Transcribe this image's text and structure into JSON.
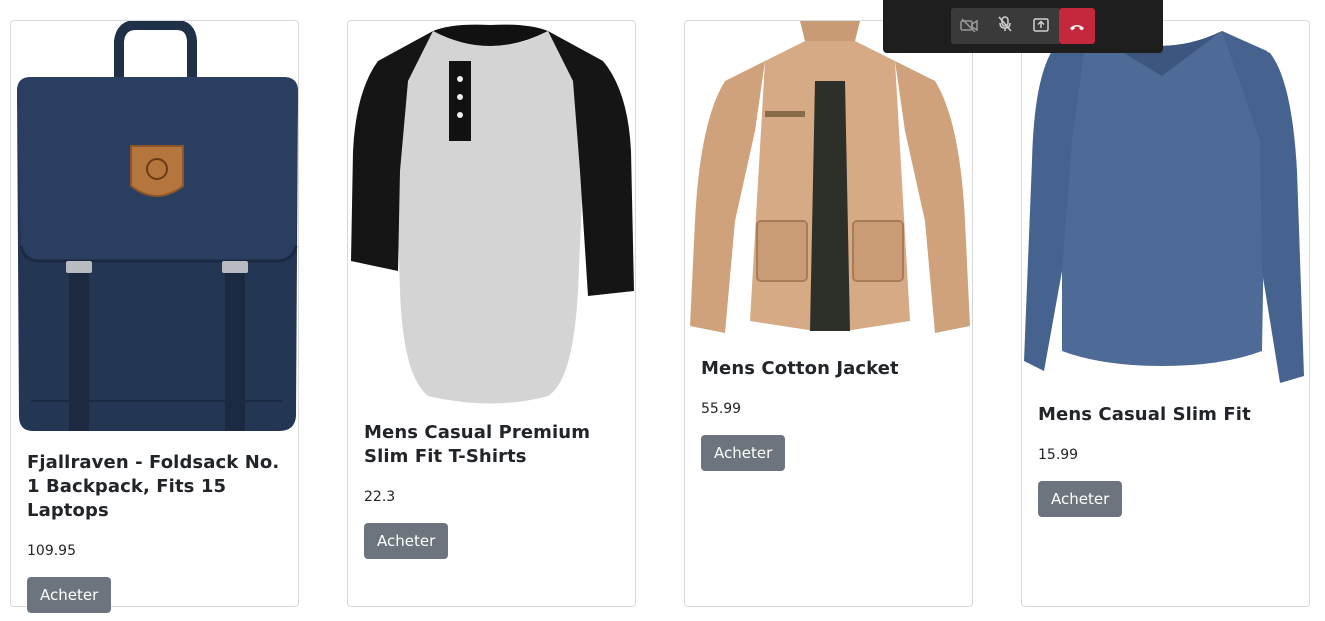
{
  "products": [
    {
      "title": "Fjallraven - Foldsack No. 1 Backpack, Fits 15 Laptops",
      "price": "109.95",
      "button": "Acheter",
      "image_icon": "backpack-image"
    },
    {
      "title": "Mens Casual Premium Slim Fit T-Shirts",
      "price": "22.3",
      "button": "Acheter",
      "image_icon": "raglan-tshirt-image"
    },
    {
      "title": "Mens Cotton Jacket",
      "price": "55.99",
      "button": "Acheter",
      "image_icon": "jacket-image"
    },
    {
      "title": "Mens Casual Slim Fit",
      "price": "15.99",
      "button": "Acheter",
      "image_icon": "longsleeve-shirt-image"
    }
  ],
  "call_controls": {
    "buttons": [
      "camera-off-icon",
      "mic-off-icon",
      "share-screen-icon",
      "hang-up-icon"
    ],
    "hangup_color": "#c4283d"
  },
  "colors": {
    "button_bg": "#6c757d",
    "card_border": "#d9d9d9"
  }
}
